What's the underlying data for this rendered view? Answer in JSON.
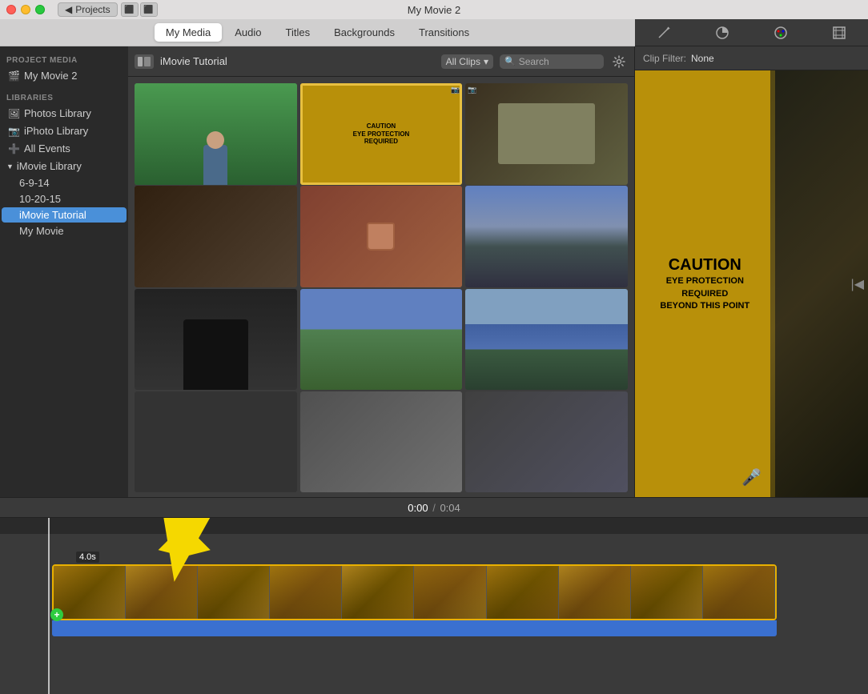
{
  "window": {
    "title": "My Movie 2"
  },
  "titleBar": {
    "trafficLights": [
      "close",
      "minimize",
      "maximize"
    ],
    "backLabel": "◀",
    "projectsLabel": "Projects",
    "navBack": "◀",
    "navForward": "▶"
  },
  "toolbar": {
    "tabs": [
      "My Media",
      "Audio",
      "Titles",
      "Backgrounds",
      "Transitions"
    ],
    "activeTab": "My Media"
  },
  "sidebar": {
    "projectMediaLabel": "PROJECT MEDIA",
    "myMovieLabel": "My Movie 2",
    "librariesLabel": "LIBRARIES",
    "photosLibrary": "Photos Library",
    "iPhotoLibrary": "iPhoto Library",
    "allEvents": "All Events",
    "iMovieLibraryLabel": "iMovie Library",
    "subItems": [
      "6-9-14",
      "10-20-15",
      "iMovie Tutorial",
      "My Movie"
    ]
  },
  "mediaBrowser": {
    "title": "iMovie Tutorial",
    "clipFilterLabel": "All Clips",
    "searchPlaceholder": "Search",
    "thumbs": [
      {
        "id": "thumb1",
        "type": "green-person"
      },
      {
        "id": "thumb2",
        "type": "caution-selected"
      },
      {
        "id": "thumb3",
        "type": "workshop"
      },
      {
        "id": "thumb4",
        "type": "dark-machinery"
      },
      {
        "id": "thumb5",
        "type": "mug"
      },
      {
        "id": "thumb6",
        "type": "building-exterior"
      },
      {
        "id": "thumb7",
        "type": "woman-dark"
      },
      {
        "id": "thumb8",
        "type": "lawn"
      },
      {
        "id": "thumb9",
        "type": "modern-building"
      },
      {
        "id": "thumb10",
        "type": "woman2"
      },
      {
        "id": "thumb11",
        "type": "statue"
      },
      {
        "id": "thumb12",
        "type": "warehouse"
      }
    ]
  },
  "preview": {
    "clipFilterLabel": "Clip Filter:",
    "clipFilterValue": "None",
    "cautionLines": [
      "CAUTION",
      "EYE PROTECTION",
      "REQUIRED",
      "BEYOND THIS POINT"
    ]
  },
  "timeline": {
    "timecurrent": "0:00",
    "timetotal": "0:04",
    "timeSeparator": "/",
    "clipDuration": "4.0s"
  }
}
